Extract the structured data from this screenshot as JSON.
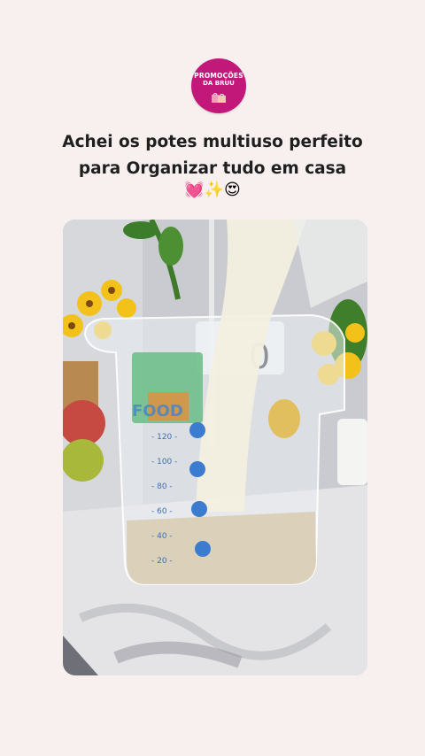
{
  "header": {
    "logo_line1": "PROMOÇÕES",
    "logo_line2": "DA BRUU"
  },
  "post": {
    "caption_line1": "Achei os potes multiuso perfeito",
    "caption_line2": "para Organizar tudo em casa",
    "emojis": "💓✨😍"
  },
  "media": {
    "container_label": "FOOD",
    "scale_marks": [
      "120",
      "100",
      "80",
      "60",
      "40",
      "20"
    ]
  },
  "colors": {
    "brand": "#c2187a",
    "background": "#f7f0ef"
  }
}
